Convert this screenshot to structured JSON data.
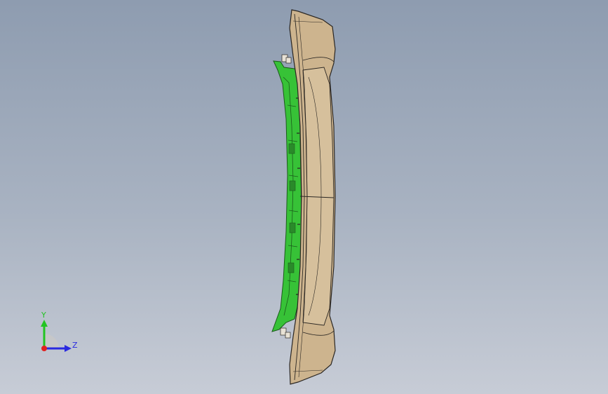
{
  "viewport": {
    "background_top": "#8e9cb0",
    "background_bottom": "#c7ccd6"
  },
  "model": {
    "description_icon": "bumper-part-icon",
    "shell_color": "#cdb48e",
    "inner_color": "#37c237",
    "edge_color": "#2a2622"
  },
  "triad": {
    "y_label": "Y",
    "z_label": "Z",
    "y_color": "#22c422",
    "z_color": "#2a2ae0",
    "origin_color": "#e02020"
  }
}
